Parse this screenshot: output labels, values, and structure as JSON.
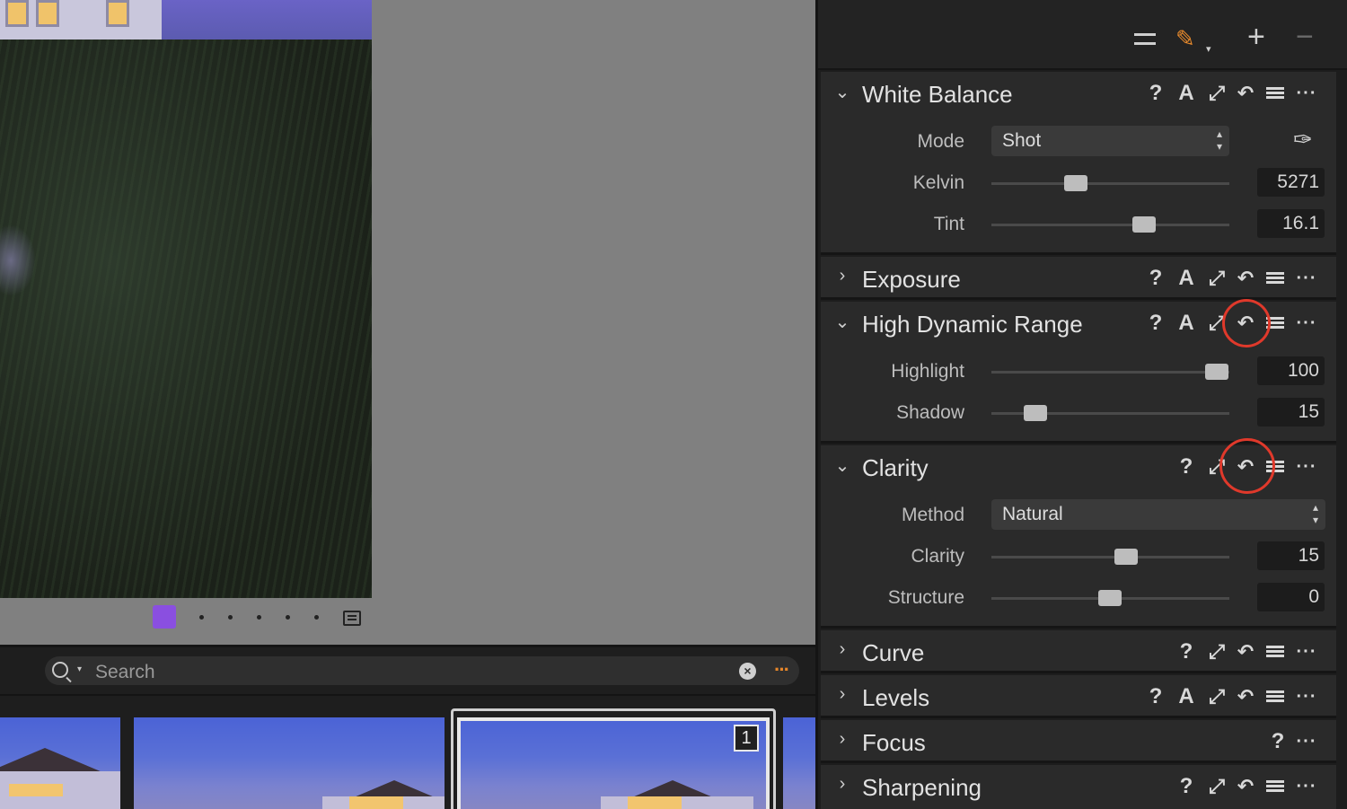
{
  "viewer": {
    "color_tag_color": "#8a4fe0"
  },
  "browser": {
    "search": {
      "placeholder": "Search"
    },
    "selected_thumbnail_badge": "1"
  },
  "panel": {
    "toolbar": {
      "icons": [
        "sliders-icon",
        "brush-icon",
        "plus-icon",
        "minus-icon"
      ],
      "brush_color": "#e88a2c"
    },
    "tools": {
      "white_balance": {
        "title": "White Balance",
        "expanded": true,
        "mode_label": "Mode",
        "mode_value": "Shot",
        "kelvin_label": "Kelvin",
        "kelvin_value": "5271",
        "tint_label": "Tint",
        "tint_value": "16.1"
      },
      "exposure": {
        "title": "Exposure",
        "expanded": false
      },
      "hdr": {
        "title": "High Dynamic Range",
        "expanded": true,
        "highlight_label": "Highlight",
        "highlight_value": "100",
        "shadow_label": "Shadow",
        "shadow_value": "15"
      },
      "clarity": {
        "title": "Clarity",
        "expanded": true,
        "method_label": "Method",
        "method_value": "Natural",
        "clarity_label": "Clarity",
        "clarity_value": "15",
        "structure_label": "Structure",
        "structure_value": "0"
      },
      "curve": {
        "title": "Curve",
        "expanded": false
      },
      "levels": {
        "title": "Levels",
        "expanded": false
      },
      "focus": {
        "title": "Focus",
        "expanded": false
      },
      "sharpening": {
        "title": "Sharpening",
        "expanded": false
      }
    },
    "header_icon_glyphs": {
      "help": "?",
      "auto": "A",
      "more": "···"
    },
    "highlight_ring_color": "#e0392b"
  }
}
